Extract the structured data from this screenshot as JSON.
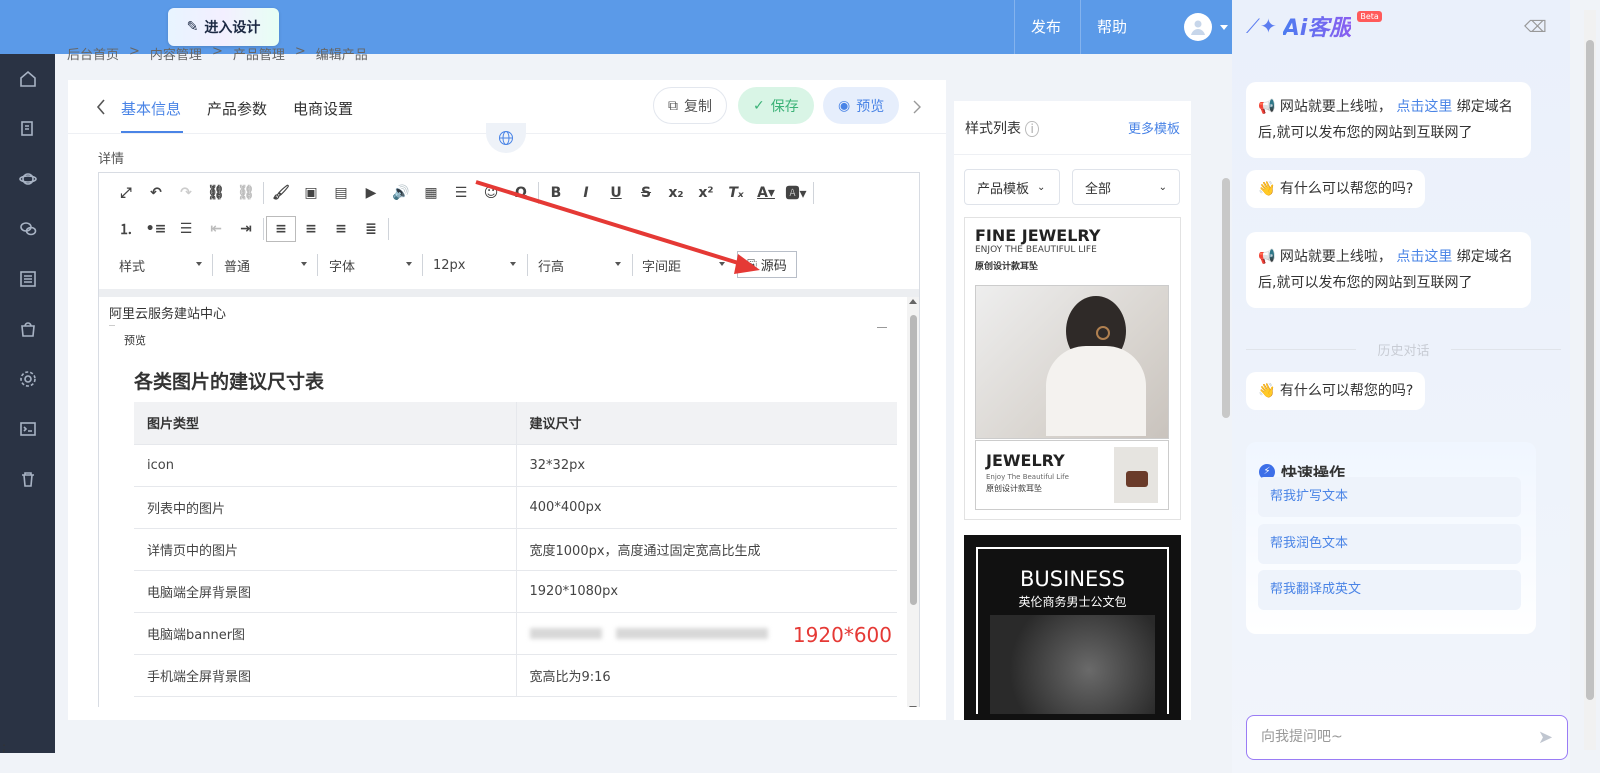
{
  "topbar": {
    "design_label": "进入设计",
    "publish": "发布",
    "help": "帮助"
  },
  "breadcrumb": [
    "后台首页",
    ">",
    "内容管理",
    ">",
    "产品管理",
    ">",
    "编辑产品"
  ],
  "tabs": [
    "基本信息",
    "产品参数",
    "电商设置"
  ],
  "actions": {
    "copy": "复制",
    "save": "保存",
    "preview": "预览"
  },
  "detail_label": "详情",
  "toolbar_selects": {
    "style": "样式",
    "format": "普通",
    "font": "字体",
    "size": "12px",
    "line_height": "行高",
    "letter_spacing": "字间距"
  },
  "source_button": "源码",
  "editor": {
    "site_title": "阿里云服务建站中心",
    "mini_preview": "预览",
    "heading": "各类图片的建议尺寸表",
    "table_headers": [
      "图片类型",
      "建议尺寸"
    ],
    "table_rows": [
      [
        "icon",
        "32*32px"
      ],
      [
        "列表中的图片",
        "400*400px"
      ],
      [
        "详情页中的图片",
        "宽度1000px，高度通过固定宽高比生成"
      ],
      [
        "电脑端全屏背景图",
        "1920*1080px"
      ],
      [
        "电脑端banner图",
        ""
      ],
      [
        "手机端全屏背景图",
        "宽高比为9:16"
      ]
    ],
    "banner_size": "1920*600"
  },
  "style_panel": {
    "title": "样式列表",
    "more": "更多模板",
    "select1": "产品模板",
    "select2": "全部",
    "tpl1": {
      "title": "FINE JEWELRY",
      "sub": "ENJOY THE BEAUTIFUL LIFE",
      "cn": "原创设计款耳坠",
      "bottom_title": "JEWELRY",
      "bottom_sub": "Enjoy The Beautiful Life",
      "bottom_cn": "原创设计款耳坠"
    },
    "tpl2": {
      "title": "BUSINESS",
      "cn": "英伦商务男士公文包"
    }
  },
  "ai": {
    "brand": "Ai客服",
    "beta": "Beta",
    "msg1_pre": "网站就要上线啦，",
    "msg1_link": "点击这里",
    "msg1_post": "绑定域名后,就可以发布您的网站到互联网了",
    "msg2": "有什么可以帮您的吗?",
    "history": "历史对话",
    "quick_title": "快速操作",
    "quick_items": [
      "帮我扩写文本",
      "帮我润色文本",
      "帮我翻译成英文"
    ],
    "input_placeholder": "向我提问吧~"
  },
  "colors": {
    "topbar": "#5b9ae8",
    "sidebar": "#2a3344",
    "accent": "#4a84e6",
    "arrow": "#e53935"
  },
  "semi": ";"
}
